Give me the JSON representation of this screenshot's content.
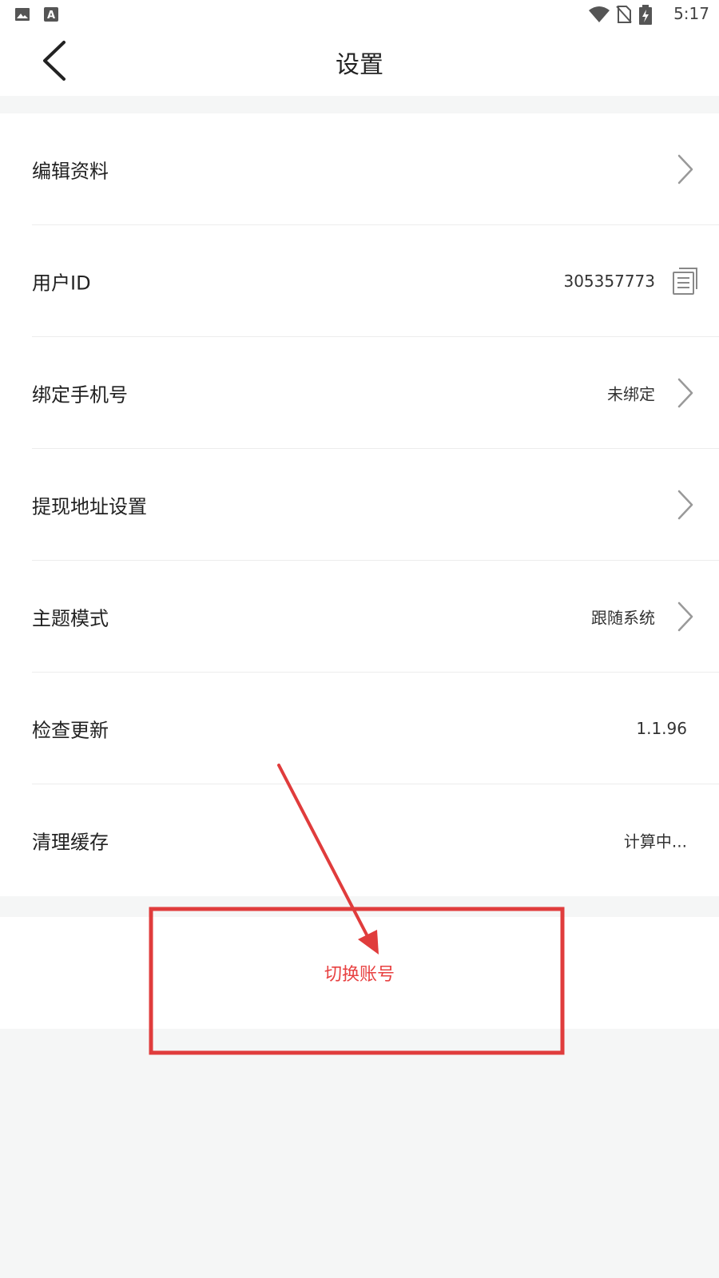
{
  "status_bar": {
    "time": "5:17",
    "left_icons": [
      "image-icon",
      "a-letter-icon"
    ],
    "right_icons": [
      "wifi-icon",
      "no-sim-icon",
      "battery-charging-icon"
    ]
  },
  "header": {
    "title": "设置",
    "back_icon": "chevron-left-icon"
  },
  "settings": {
    "items": [
      {
        "label": "编辑资料",
        "value": "",
        "icon": "chevron-right-icon"
      },
      {
        "label": "用户ID",
        "value": "305357773",
        "icon": "copy-icon"
      },
      {
        "label": "绑定手机号",
        "value": "未绑定",
        "icon": "chevron-right-icon"
      },
      {
        "label": "提现地址设置",
        "value": "",
        "icon": "chevron-right-icon"
      },
      {
        "label": "主题模式",
        "value": "跟随系统",
        "icon": "chevron-right-icon"
      },
      {
        "label": "检查更新",
        "value": "1.1.96",
        "icon": ""
      },
      {
        "label": "清理缓存",
        "value": "计算中...",
        "icon": ""
      }
    ]
  },
  "switch_account": {
    "label": "切换账号"
  },
  "colors": {
    "accent_red": "#e84141",
    "background": "#f5f6f6",
    "row_bg": "#ffffff"
  }
}
